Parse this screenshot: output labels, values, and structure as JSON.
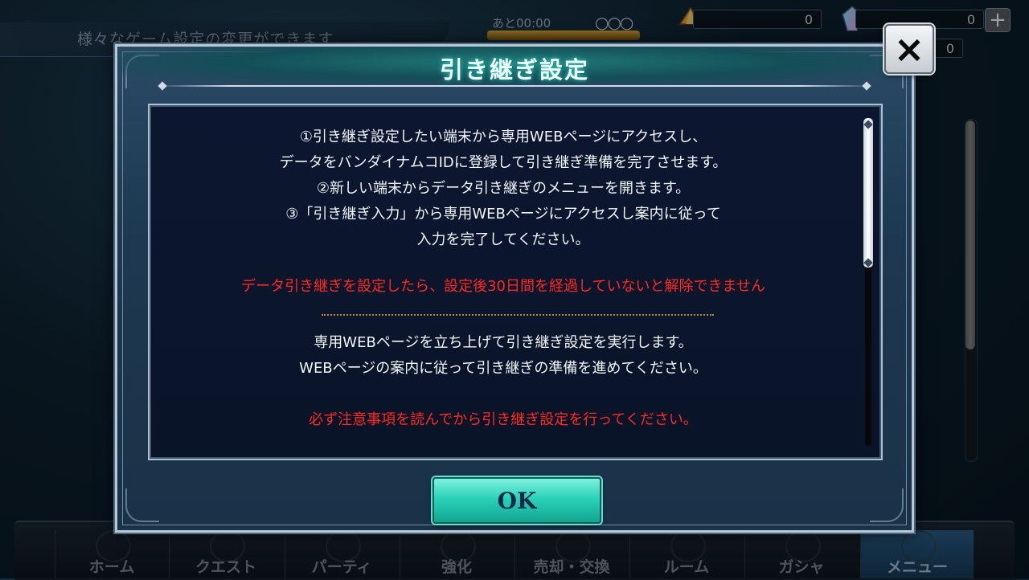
{
  "background": {
    "header_text": "様々なゲーム設定の変更ができます",
    "timer": "あと00:00",
    "dots": "○○○",
    "resource1_value": "0",
    "resource2_value": "0",
    "resource3_value": "0",
    "plus_label": "+"
  },
  "nav": {
    "items": [
      {
        "label": "ホーム"
      },
      {
        "label": "クエスト"
      },
      {
        "label": "パーティ"
      },
      {
        "label": "強化"
      },
      {
        "label": "売却・交換"
      },
      {
        "label": "ルーム"
      },
      {
        "label": "ガシャ"
      },
      {
        "label": "メニュー"
      }
    ]
  },
  "modal": {
    "title": "引き継ぎ設定",
    "close_label": "×",
    "paragraph1": [
      "①引き継ぎ設定したい端末から専用WEBページにアクセスし、",
      "データをバンダイナムコIDに登録して引き継ぎ準備を完了させます。",
      "②新しい端末からデータ引き継ぎのメニューを開きます。",
      "③「引き継ぎ入力」から専用WEBページにアクセスし案内に従って",
      "入力を完了してください。"
    ],
    "warning1": "データ引き継ぎを設定したら、設定後30日間を経過していないと解除できません",
    "paragraph2": [
      "専用WEBページを立ち上げて引き継ぎ設定を実行します。",
      "WEBページの案内に従って引き継ぎの準備を進めてください。"
    ],
    "warning2": "必ず注意事項を読んでから引き継ぎ設定を行ってください。",
    "ok_label": "OK"
  },
  "colors": {
    "warning": "#ff2a22",
    "ok_button": "#2ad2b8",
    "title_glow": "#2ee7d8"
  }
}
